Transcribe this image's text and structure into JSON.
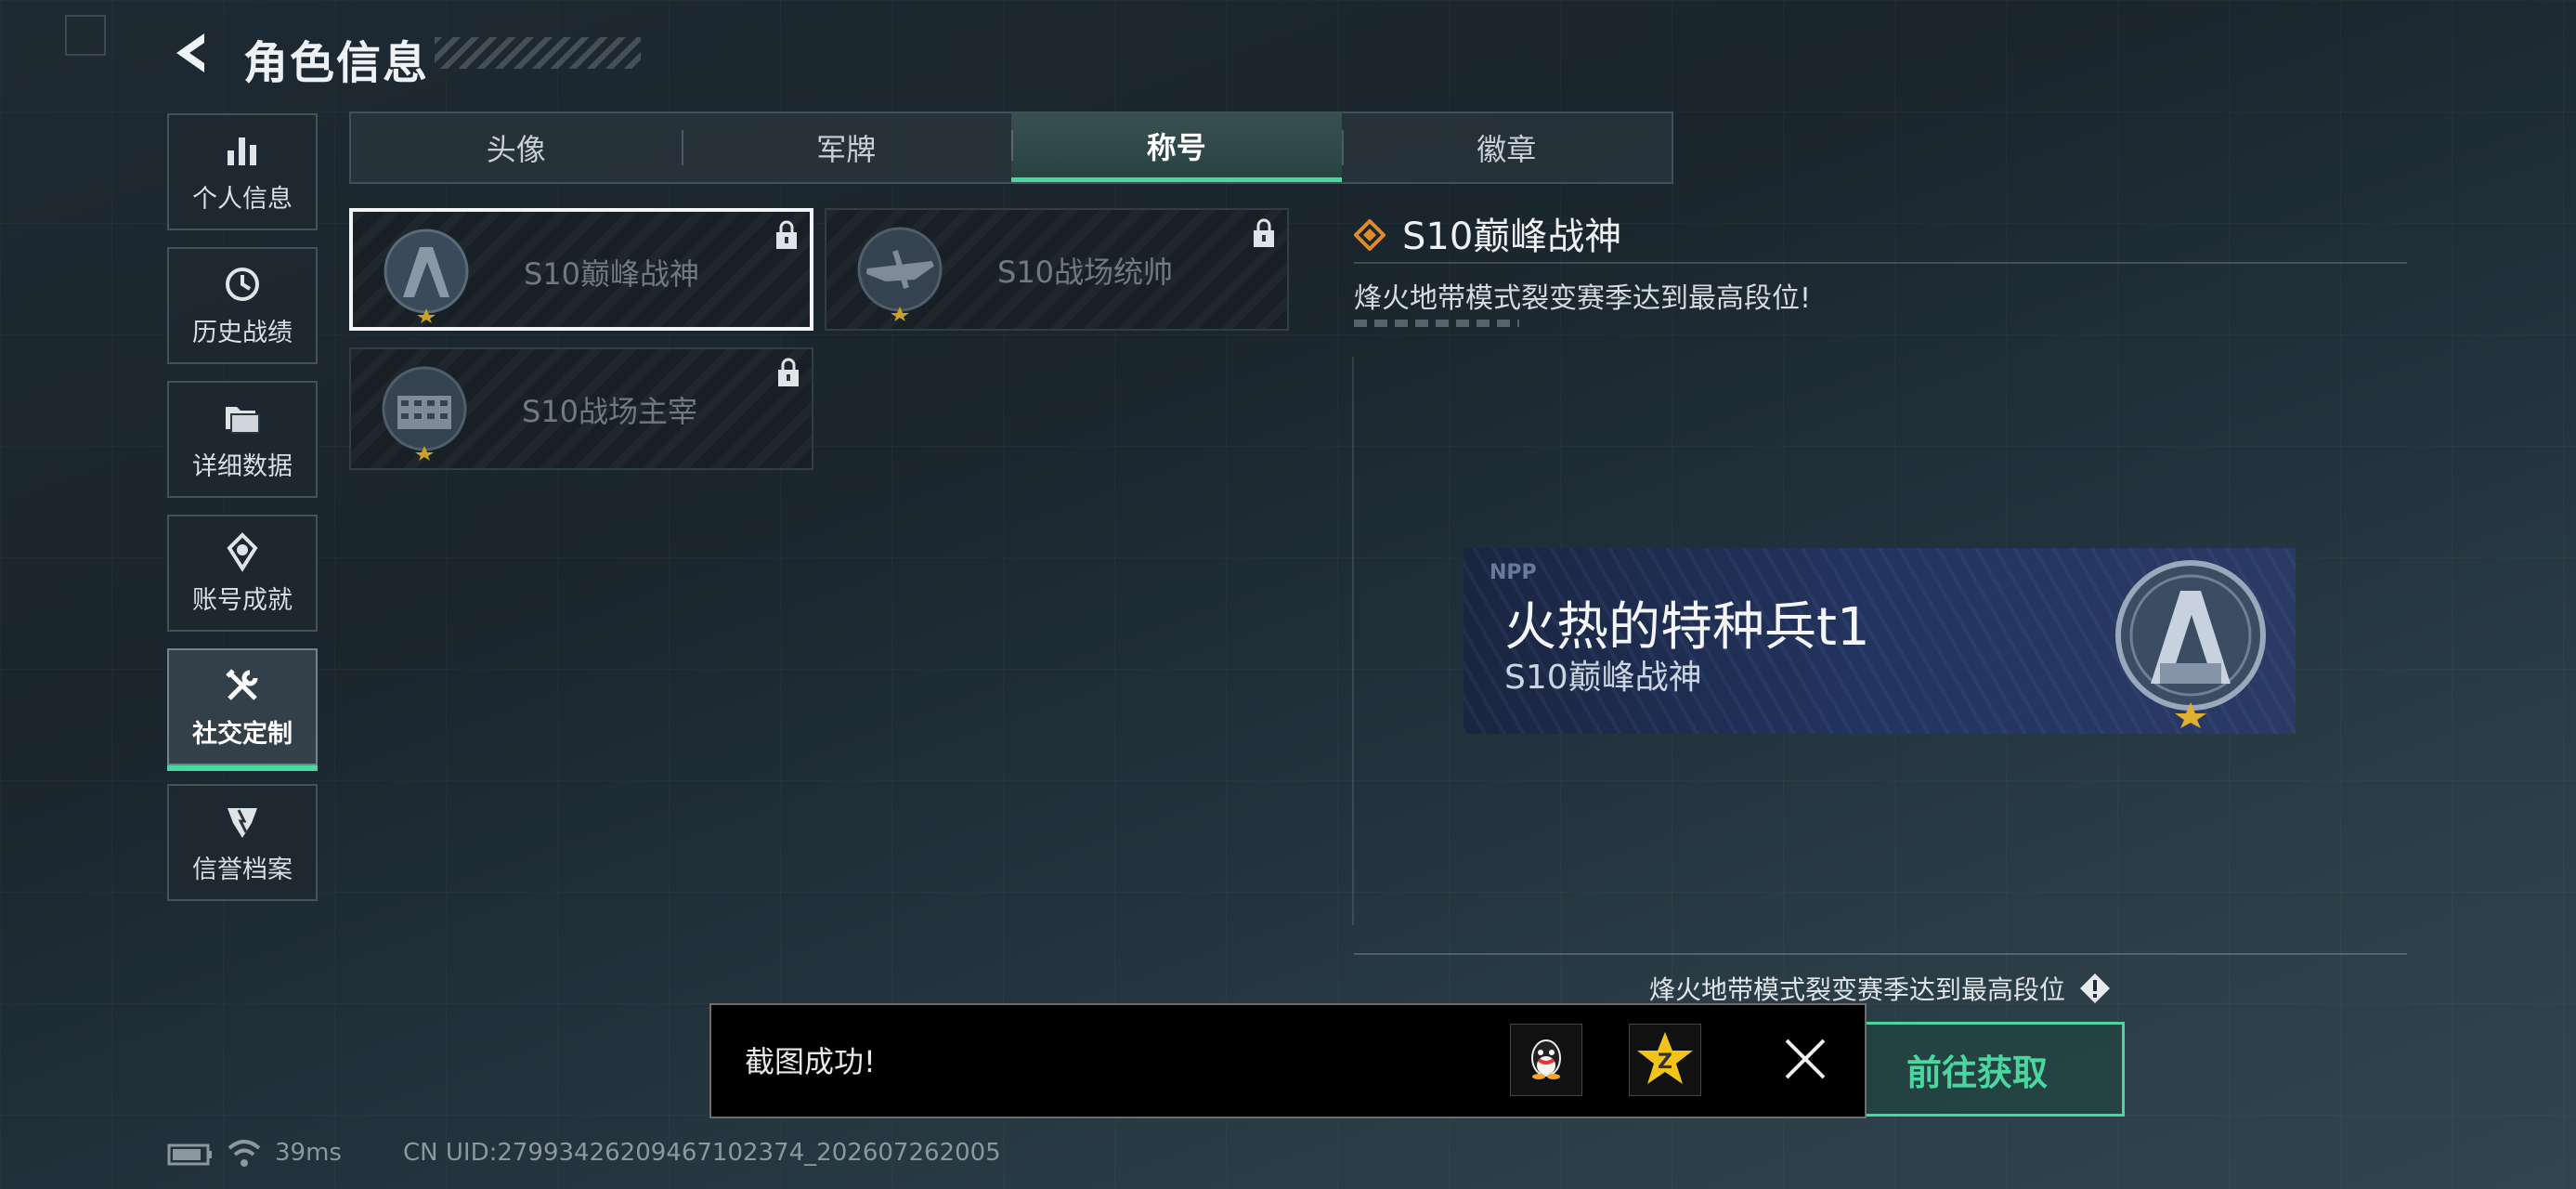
{
  "header": {
    "title": "角色信息"
  },
  "sidebar": {
    "items": [
      {
        "label": "个人信息",
        "icon": "bar-chart-icon"
      },
      {
        "label": "历史战绩",
        "icon": "history-clock-icon"
      },
      {
        "label": "详细数据",
        "icon": "folder-icon"
      },
      {
        "label": "账号成就",
        "icon": "medal-icon"
      },
      {
        "label": "社交定制",
        "icon": "tools-icon",
        "active": true
      },
      {
        "label": "信誉档案",
        "icon": "shield-icon"
      }
    ]
  },
  "tabs": [
    {
      "label": "头像"
    },
    {
      "label": "军牌"
    },
    {
      "label": "称号",
      "active": true
    },
    {
      "label": "徽章"
    }
  ],
  "titles": [
    {
      "name": "S10巅峰战神",
      "locked": true,
      "selected": true
    },
    {
      "name": "S10战场统帅",
      "locked": true
    },
    {
      "name": "S10战场主宰",
      "locked": true
    }
  ],
  "detail": {
    "title": "S10巅峰战神",
    "description": "烽火地带模式裂变赛季达到最高段位!",
    "nameplate": {
      "badge_text": "NPP",
      "player_name": "火热的特种兵t1",
      "title": "S10巅峰战神"
    },
    "source_text": "烽火地带模式裂变赛季达到最高段位",
    "go_button_label": "前往获取"
  },
  "toast": {
    "message": "截图成功!"
  },
  "status": {
    "ping": "39ms",
    "uid": "CN UID:27993426209467102374_202607262005"
  },
  "colors": {
    "accent": "#4bd6a0",
    "background": "#1e2a33",
    "nameplate": "#233460"
  }
}
